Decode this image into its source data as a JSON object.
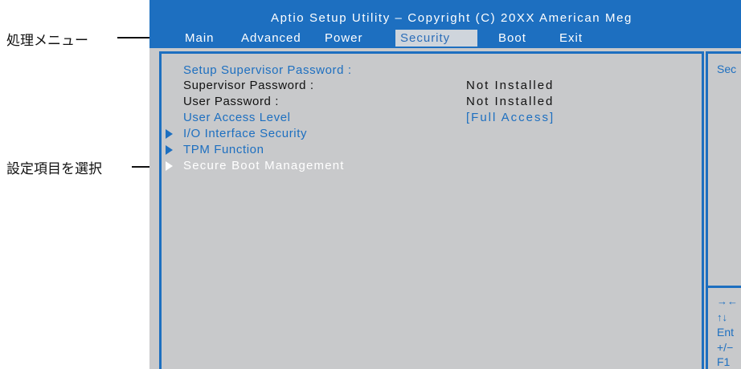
{
  "annotations": {
    "menu_label": "処理メニュー",
    "select_label": "設定項目を選択"
  },
  "title": "Aptio Setup Utility – Copyright (C) 20XX American Meg",
  "menu": {
    "items": [
      "Main",
      "Advanced",
      "Power",
      "Security",
      "Boot",
      "Exit"
    ],
    "active": "Security"
  },
  "security": {
    "section_title": "Setup Supervisor Password :",
    "supervisor_label": "Supervisor Password :",
    "supervisor_value": "Not Installed",
    "user_label": "User Password :",
    "user_value": "Not Installed",
    "access_label": "User Access Level",
    "access_value": "[Full Access]",
    "submenus": [
      "I/O Interface Security",
      "TPM Function",
      "Secure Boot Management"
    ],
    "selected_submenu": "Secure Boot Management"
  },
  "help": {
    "text": "Sec",
    "keys": [
      "→←",
      "↑↓",
      "Ent",
      "+/−",
      "F1"
    ]
  },
  "colors": {
    "bios_blue": "#1d6fc0",
    "bios_gray": "#c8c9cb",
    "active_tab_bg": "#cfd5dc"
  }
}
